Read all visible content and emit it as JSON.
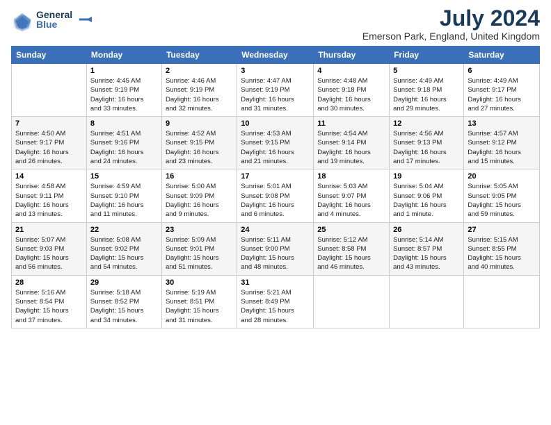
{
  "header": {
    "logo_line1": "General",
    "logo_line2": "Blue",
    "month_year": "July 2024",
    "location": "Emerson Park, England, United Kingdom"
  },
  "days_of_week": [
    "Sunday",
    "Monday",
    "Tuesday",
    "Wednesday",
    "Thursday",
    "Friday",
    "Saturday"
  ],
  "weeks": [
    [
      {
        "day": "",
        "info": ""
      },
      {
        "day": "1",
        "info": "Sunrise: 4:45 AM\nSunset: 9:19 PM\nDaylight: 16 hours\nand 33 minutes."
      },
      {
        "day": "2",
        "info": "Sunrise: 4:46 AM\nSunset: 9:19 PM\nDaylight: 16 hours\nand 32 minutes."
      },
      {
        "day": "3",
        "info": "Sunrise: 4:47 AM\nSunset: 9:19 PM\nDaylight: 16 hours\nand 31 minutes."
      },
      {
        "day": "4",
        "info": "Sunrise: 4:48 AM\nSunset: 9:18 PM\nDaylight: 16 hours\nand 30 minutes."
      },
      {
        "day": "5",
        "info": "Sunrise: 4:49 AM\nSunset: 9:18 PM\nDaylight: 16 hours\nand 29 minutes."
      },
      {
        "day": "6",
        "info": "Sunrise: 4:49 AM\nSunset: 9:17 PM\nDaylight: 16 hours\nand 27 minutes."
      }
    ],
    [
      {
        "day": "7",
        "info": "Sunrise: 4:50 AM\nSunset: 9:17 PM\nDaylight: 16 hours\nand 26 minutes."
      },
      {
        "day": "8",
        "info": "Sunrise: 4:51 AM\nSunset: 9:16 PM\nDaylight: 16 hours\nand 24 minutes."
      },
      {
        "day": "9",
        "info": "Sunrise: 4:52 AM\nSunset: 9:15 PM\nDaylight: 16 hours\nand 23 minutes."
      },
      {
        "day": "10",
        "info": "Sunrise: 4:53 AM\nSunset: 9:15 PM\nDaylight: 16 hours\nand 21 minutes."
      },
      {
        "day": "11",
        "info": "Sunrise: 4:54 AM\nSunset: 9:14 PM\nDaylight: 16 hours\nand 19 minutes."
      },
      {
        "day": "12",
        "info": "Sunrise: 4:56 AM\nSunset: 9:13 PM\nDaylight: 16 hours\nand 17 minutes."
      },
      {
        "day": "13",
        "info": "Sunrise: 4:57 AM\nSunset: 9:12 PM\nDaylight: 16 hours\nand 15 minutes."
      }
    ],
    [
      {
        "day": "14",
        "info": "Sunrise: 4:58 AM\nSunset: 9:11 PM\nDaylight: 16 hours\nand 13 minutes."
      },
      {
        "day": "15",
        "info": "Sunrise: 4:59 AM\nSunset: 9:10 PM\nDaylight: 16 hours\nand 11 minutes."
      },
      {
        "day": "16",
        "info": "Sunrise: 5:00 AM\nSunset: 9:09 PM\nDaylight: 16 hours\nand 9 minutes."
      },
      {
        "day": "17",
        "info": "Sunrise: 5:01 AM\nSunset: 9:08 PM\nDaylight: 16 hours\nand 6 minutes."
      },
      {
        "day": "18",
        "info": "Sunrise: 5:03 AM\nSunset: 9:07 PM\nDaylight: 16 hours\nand 4 minutes."
      },
      {
        "day": "19",
        "info": "Sunrise: 5:04 AM\nSunset: 9:06 PM\nDaylight: 16 hours\nand 1 minute."
      },
      {
        "day": "20",
        "info": "Sunrise: 5:05 AM\nSunset: 9:05 PM\nDaylight: 15 hours\nand 59 minutes."
      }
    ],
    [
      {
        "day": "21",
        "info": "Sunrise: 5:07 AM\nSunset: 9:03 PM\nDaylight: 15 hours\nand 56 minutes."
      },
      {
        "day": "22",
        "info": "Sunrise: 5:08 AM\nSunset: 9:02 PM\nDaylight: 15 hours\nand 54 minutes."
      },
      {
        "day": "23",
        "info": "Sunrise: 5:09 AM\nSunset: 9:01 PM\nDaylight: 15 hours\nand 51 minutes."
      },
      {
        "day": "24",
        "info": "Sunrise: 5:11 AM\nSunset: 9:00 PM\nDaylight: 15 hours\nand 48 minutes."
      },
      {
        "day": "25",
        "info": "Sunrise: 5:12 AM\nSunset: 8:58 PM\nDaylight: 15 hours\nand 46 minutes."
      },
      {
        "day": "26",
        "info": "Sunrise: 5:14 AM\nSunset: 8:57 PM\nDaylight: 15 hours\nand 43 minutes."
      },
      {
        "day": "27",
        "info": "Sunrise: 5:15 AM\nSunset: 8:55 PM\nDaylight: 15 hours\nand 40 minutes."
      }
    ],
    [
      {
        "day": "28",
        "info": "Sunrise: 5:16 AM\nSunset: 8:54 PM\nDaylight: 15 hours\nand 37 minutes."
      },
      {
        "day": "29",
        "info": "Sunrise: 5:18 AM\nSunset: 8:52 PM\nDaylight: 15 hours\nand 34 minutes."
      },
      {
        "day": "30",
        "info": "Sunrise: 5:19 AM\nSunset: 8:51 PM\nDaylight: 15 hours\nand 31 minutes."
      },
      {
        "day": "31",
        "info": "Sunrise: 5:21 AM\nSunset: 8:49 PM\nDaylight: 15 hours\nand 28 minutes."
      },
      {
        "day": "",
        "info": ""
      },
      {
        "day": "",
        "info": ""
      },
      {
        "day": "",
        "info": ""
      }
    ]
  ]
}
